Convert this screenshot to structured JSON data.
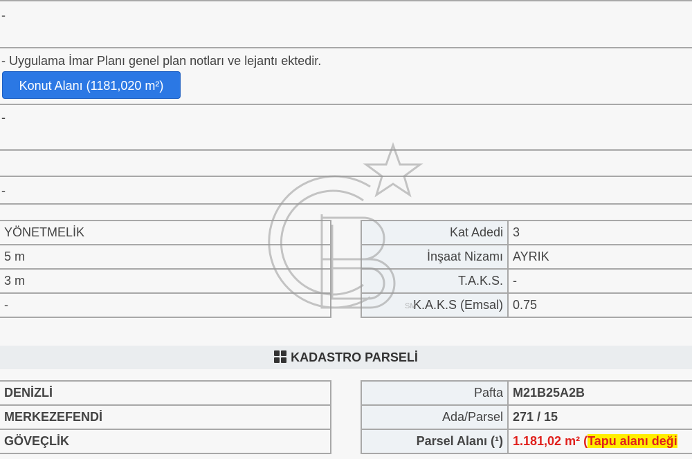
{
  "plan": {
    "row1_text": "-",
    "note_text": "- Uygulama İmar Planı genel plan notları ve lejantı ektedir.",
    "zone_button_label": "Konut Alanı (1181,020 m²)",
    "row3_text": "-",
    "row5_text": "-"
  },
  "regulation": {
    "left_values": [
      "YÖNETMELİK",
      "5 m",
      "3 m",
      "-"
    ],
    "right": [
      {
        "label": "Kat Adedi",
        "value": "3"
      },
      {
        "label": "İnşaat Nizamı",
        "value": "AYRIK"
      },
      {
        "label": "T.A.K.S.",
        "value": "-"
      },
      {
        "label": "K.A.K.S (Emsal)",
        "value": "0.75"
      }
    ]
  },
  "kadastro": {
    "title": "KADASTRO PARSELİ",
    "icon": "grid-icon",
    "left_values": [
      "DENİZLİ",
      "MERKEZEFENDİ",
      "GÖVEÇLİK"
    ],
    "right": [
      {
        "label": "Pafta",
        "value": "M21B25A2B"
      },
      {
        "label": "Ada/Parsel",
        "value": "271 / 15"
      }
    ],
    "area_label": "Parsel Alanı (¹)",
    "area_value": "1.181,02 m² (",
    "area_note": "Tapu alanı deği"
  },
  "watermark": {
    "icon": "cb-logo-icon",
    "mark": "SM"
  },
  "colors": {
    "button": "#2b78e4",
    "alert": "#e0201c",
    "highlight": "#ffee00"
  }
}
